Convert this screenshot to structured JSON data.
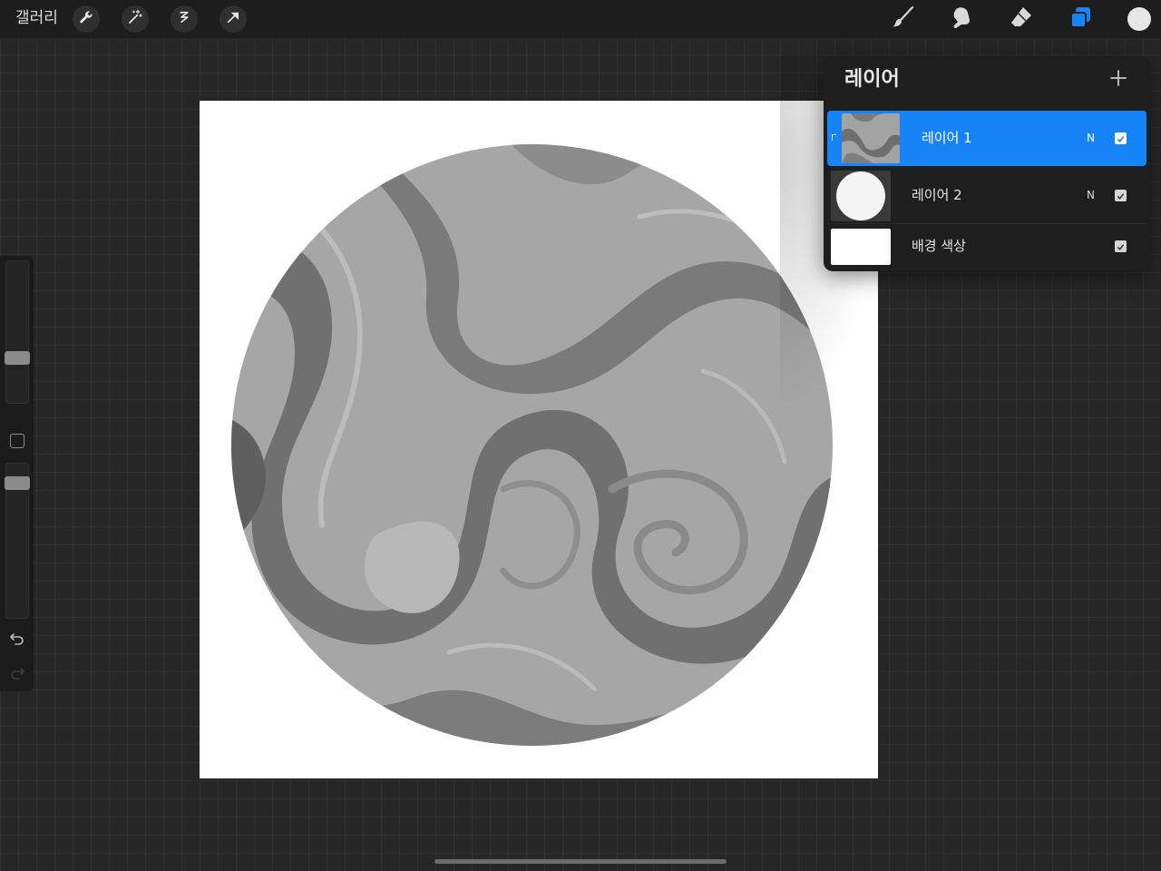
{
  "topbar": {
    "gallery_label": "갤러리",
    "tools_left": [
      {
        "name": "actions",
        "icon": "wrench-icon"
      },
      {
        "name": "adjustments",
        "icon": "magic-wand-icon"
      },
      {
        "name": "selection",
        "icon": "selection-s-icon"
      },
      {
        "name": "transform",
        "icon": "arrow-cursor-icon"
      }
    ],
    "tools_right": [
      {
        "name": "brush",
        "icon": "brush-icon"
      },
      {
        "name": "smudge",
        "icon": "smudge-finger-icon"
      },
      {
        "name": "eraser",
        "icon": "eraser-icon"
      },
      {
        "name": "layers",
        "icon": "layers-icon",
        "active": true
      }
    ],
    "current_color": "#e7e7e7"
  },
  "sidebar": {
    "brush_size_level": 0.33,
    "opacity_level": 0.9
  },
  "layers_panel": {
    "title": "레이어",
    "layers": [
      {
        "name": "레이어 1",
        "blend_mode": "N",
        "visible": true,
        "selected": true,
        "clipping": true
      },
      {
        "name": "레이어 2",
        "blend_mode": "N",
        "visible": true,
        "selected": false
      },
      {
        "name": "배경 색상",
        "blend_mode": "",
        "visible": true,
        "selected": false
      }
    ]
  },
  "colors": {
    "accent": "#1683f6",
    "canvas": "#ffffff",
    "marble_light": "#a9a9a9",
    "marble_dark": "#6f6f6f"
  }
}
